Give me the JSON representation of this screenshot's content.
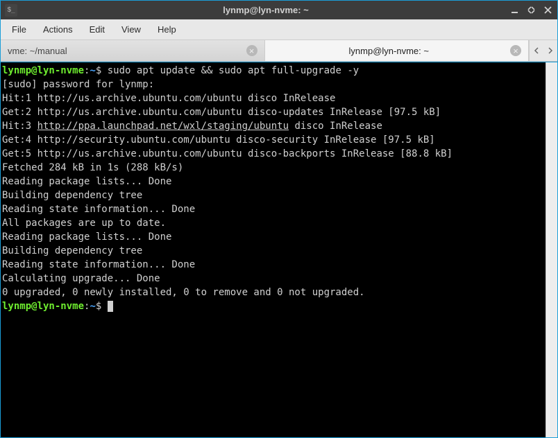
{
  "titlebar": {
    "title": "lynmp@lyn-nvme: ~",
    "icon_glyph": "$_"
  },
  "menubar": {
    "items": [
      "File",
      "Actions",
      "Edit",
      "View",
      "Help"
    ]
  },
  "tabs": {
    "inactive_label": "vme: ~/manual",
    "active_label": "lynmp@lyn-nvme: ~"
  },
  "terminal": {
    "prompt_user": "lynmp@lyn-nvme",
    "prompt_sep": ":",
    "prompt_path": "~",
    "prompt_symbol": "$",
    "command": "sudo apt update && sudo apt full-upgrade -y",
    "lines": [
      {
        "type": "text",
        "text": "[sudo] password for lynmp:"
      },
      {
        "type": "text",
        "text": "Hit:1 http://us.archive.ubuntu.com/ubuntu disco InRelease"
      },
      {
        "type": "text",
        "text": "Get:2 http://us.archive.ubuntu.com/ubuntu disco-updates InRelease [97.5 kB]"
      },
      {
        "type": "link",
        "prefix": "Hit:3 ",
        "url": "http://ppa.launchpad.net/wxl/staging/ubuntu",
        "suffix": " disco InRelease"
      },
      {
        "type": "text",
        "text": "Get:4 http://security.ubuntu.com/ubuntu disco-security InRelease [97.5 kB]"
      },
      {
        "type": "text",
        "text": "Get:5 http://us.archive.ubuntu.com/ubuntu disco-backports InRelease [88.8 kB]"
      },
      {
        "type": "text",
        "text": "Fetched 284 kB in 1s (288 kB/s)"
      },
      {
        "type": "text",
        "text": "Reading package lists... Done"
      },
      {
        "type": "text",
        "text": "Building dependency tree"
      },
      {
        "type": "text",
        "text": "Reading state information... Done"
      },
      {
        "type": "text",
        "text": "All packages are up to date."
      },
      {
        "type": "text",
        "text": "Reading package lists... Done"
      },
      {
        "type": "text",
        "text": "Building dependency tree"
      },
      {
        "type": "text",
        "text": "Reading state information... Done"
      },
      {
        "type": "text",
        "text": "Calculating upgrade... Done"
      },
      {
        "type": "text",
        "text": "0 upgraded, 0 newly installed, 0 to remove and 0 not upgraded."
      }
    ]
  }
}
